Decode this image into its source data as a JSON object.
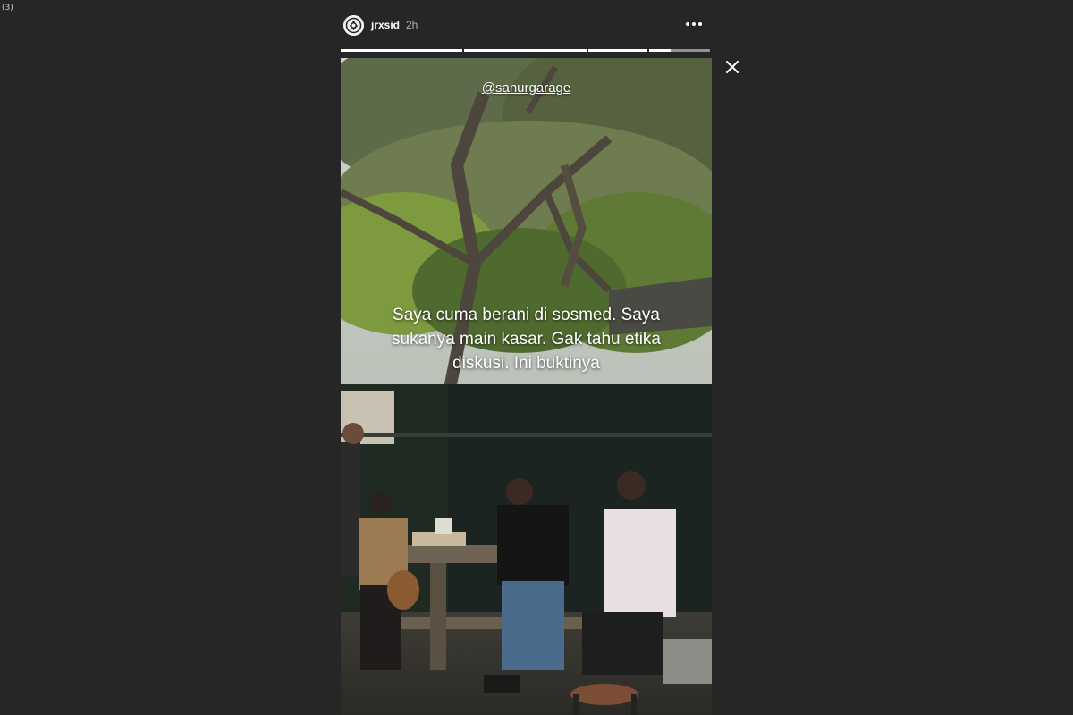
{
  "page_counter": "(3)",
  "story": {
    "username": "jrxsid",
    "time_ago": "2h",
    "progress": [
      1,
      1,
      1,
      0.35
    ],
    "mention": "@sanurgarage",
    "caption_lines": [
      "Saya cuma berani di sosmed. Saya",
      "sukanya main kasar. Gak tahu etika",
      "diskusi. Ini buktinya"
    ]
  },
  "icons": {
    "more": "more-options-icon",
    "close": "close-icon",
    "avatar": "profile-avatar"
  },
  "colors": {
    "background": "#262626",
    "text": "#ffffff",
    "muted": "#b5b5b5"
  }
}
